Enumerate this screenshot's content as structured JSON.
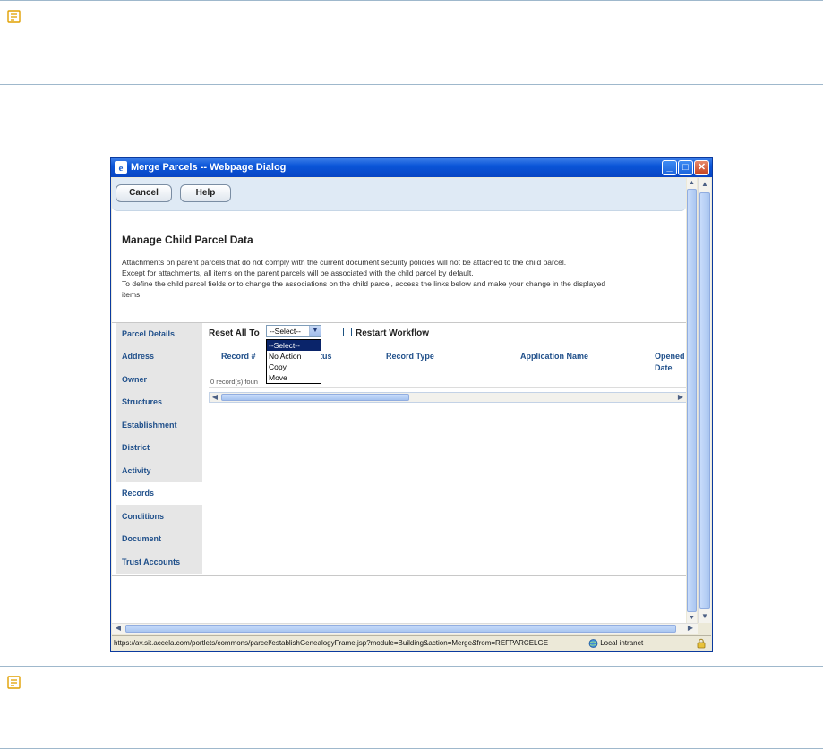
{
  "dialog": {
    "title": "Merge Parcels  -- Webpage Dialog",
    "controls": {
      "minimize": "_",
      "maximize": "□",
      "close": "✕"
    }
  },
  "toolbar": {
    "cancel_label": "Cancel",
    "help_label": "Help"
  },
  "page": {
    "heading": "Manage Child Parcel Data",
    "description": [
      "Attachments on parent parcels that do not comply with the current document security policies will not be attached to the child parcel.",
      "Except for attachments, all items on the parent parcels will be associated with the child parcel by default.",
      "To define the child parcel fields or to change the associations on the child parcel, access the links below and make your change in the displayed",
      "items."
    ]
  },
  "sidebar": {
    "items": [
      {
        "label": "Parcel Details",
        "active": false
      },
      {
        "label": "Address",
        "active": false
      },
      {
        "label": "Owner",
        "active": false
      },
      {
        "label": "Structures",
        "active": false
      },
      {
        "label": "Establishment",
        "active": false
      },
      {
        "label": "District",
        "active": false
      },
      {
        "label": "Activity",
        "active": false
      },
      {
        "label": "Records",
        "active": true
      },
      {
        "label": "Conditions",
        "active": false
      },
      {
        "label": "Document",
        "active": false
      },
      {
        "label": "Trust Accounts",
        "active": false
      }
    ]
  },
  "filter": {
    "reset_label": "Reset All To",
    "select_value": "--Select--",
    "options": [
      "--Select--",
      "No Action",
      "Copy",
      "Move"
    ],
    "restart_label": "Restart Workflow",
    "restart_checked": false
  },
  "grid": {
    "columns": [
      "Record #",
      "tus",
      "Record Type",
      "Application Name",
      "Opened",
      "Date"
    ],
    "empty_message": "0 record(s) foun"
  },
  "statusbar": {
    "url": "https://av.sit.accela.com/portlets/commons/parcel/establishGenealogyFrame.jsp?module=Building&action=Merge&from=REFPARCELGE",
    "zone": "Local intranet"
  },
  "colors": {
    "title_bar": "#0a55d8",
    "link_blue": "#1f4f8a",
    "note_border": "#9fb8cc",
    "selected_option": "#0a246a"
  }
}
